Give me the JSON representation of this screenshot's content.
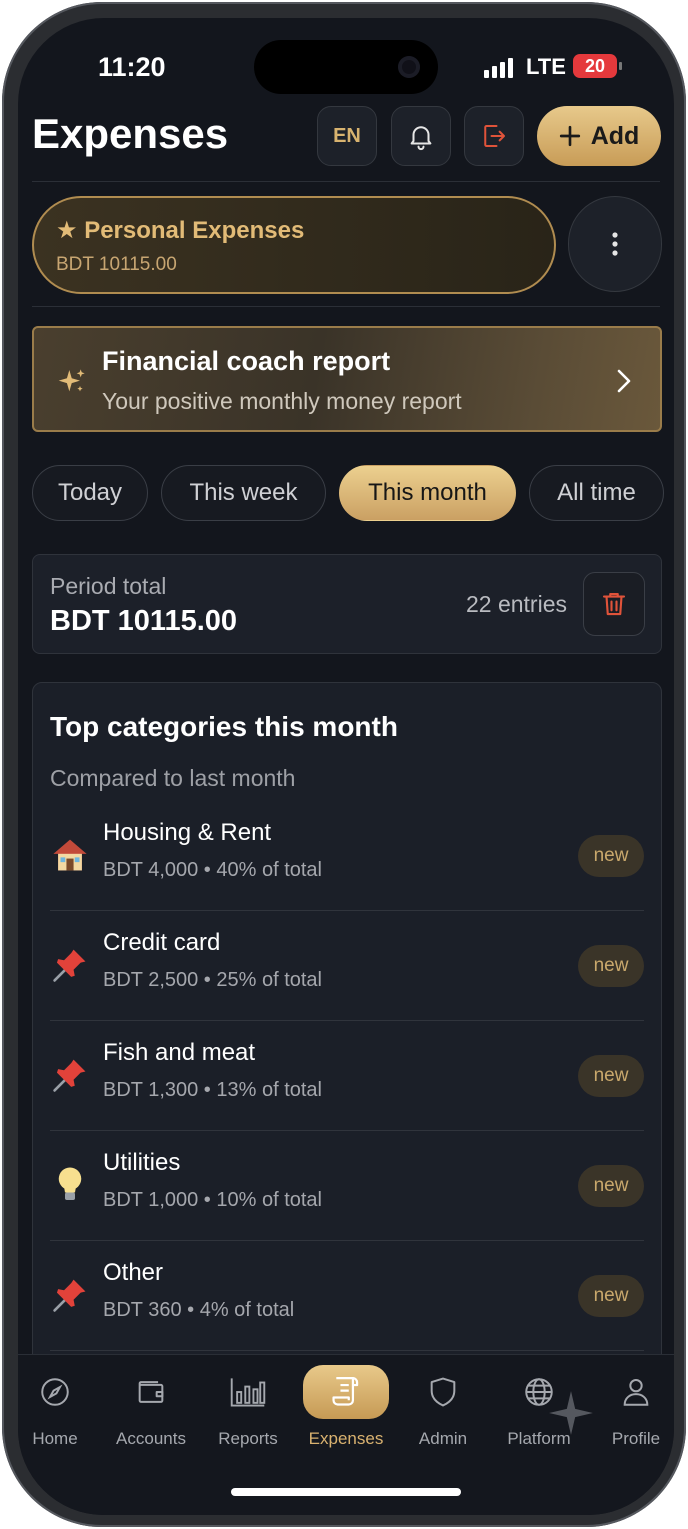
{
  "status_bar": {
    "time": "11:20",
    "network": "LTE",
    "battery": "20"
  },
  "header": {
    "title": "Expenses",
    "lang_label": "EN",
    "add_label": "Add"
  },
  "account": {
    "name": "Personal Expenses",
    "balance": "BDT 10115.00"
  },
  "coach": {
    "title": "Financial coach report",
    "subtitle": "Your positive monthly money report"
  },
  "periods": [
    {
      "label": "Today",
      "active": false
    },
    {
      "label": "This week",
      "active": false
    },
    {
      "label": "This month",
      "active": true
    },
    {
      "label": "All time",
      "active": false
    }
  ],
  "period_total": {
    "label": "Period total",
    "amount": "BDT 10115.00",
    "entries": "22 entries"
  },
  "categories": {
    "title": "Top categories this month",
    "subtitle": "Compared to last month",
    "items": [
      {
        "icon": "house-icon",
        "name": "Housing & Rent",
        "amount": "BDT 4,000",
        "share": "40% of total",
        "badge": "new"
      },
      {
        "icon": "pushpin-icon",
        "name": "Credit card",
        "amount": "BDT 2,500",
        "share": "25% of total",
        "badge": "new"
      },
      {
        "icon": "pushpin-icon",
        "name": "Fish and meat",
        "amount": "BDT 1,300",
        "share": "13% of total",
        "badge": "new"
      },
      {
        "icon": "lightbulb-icon",
        "name": "Utilities",
        "amount": "BDT 1,000",
        "share": "10% of total",
        "badge": "new"
      },
      {
        "icon": "pushpin-icon",
        "name": "Other",
        "amount": "BDT 360",
        "share": "4% of total",
        "badge": "new"
      }
    ]
  },
  "tabs": [
    {
      "label": "Home",
      "icon": "compass-icon",
      "active": false
    },
    {
      "label": "Accounts",
      "icon": "wallet-icon",
      "active": false
    },
    {
      "label": "Reports",
      "icon": "bar-chart-icon",
      "active": false
    },
    {
      "label": "Expenses",
      "icon": "receipt-icon",
      "active": true
    },
    {
      "label": "Admin",
      "icon": "shield-icon",
      "active": false
    },
    {
      "label": "Platform",
      "icon": "globe-icon",
      "active": false
    },
    {
      "label": "Profile",
      "icon": "user-icon",
      "active": false
    }
  ],
  "colors": {
    "accent": "#d9b270",
    "background": "#13161d",
    "danger": "#e0533a"
  }
}
